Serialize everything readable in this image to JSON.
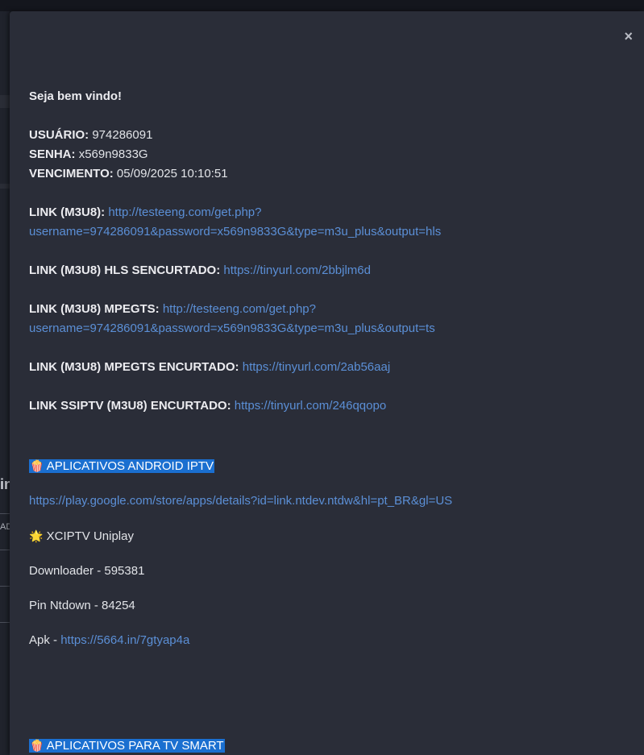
{
  "modal": {
    "close_label": "×",
    "greeting": "Seja bem vindo!",
    "user_label": "USUÁRIO:",
    "user_value": "974286091",
    "password_label": "SENHA:",
    "password_value": "x569n9833G",
    "expiry_label": "VENCIMENTO:",
    "expiry_value": "05/09/2025 10:10:51",
    "links": [
      {
        "label": "LINK (M3U8):",
        "url_line1": "http://testeeng.com/get.php?",
        "url_line2": "username=974286091&password=x569n9833G&type=m3u_plus&output=hls"
      },
      {
        "label": "LINK (M3U8) HLS SENCURTADO:",
        "url": "https://tinyurl.com/2bbjlm6d"
      },
      {
        "label": "LINK (M3U8) MPEGTS:",
        "url_line1": "http://testeeng.com/get.php?",
        "url_line2": "username=974286091&password=x569n9833G&type=m3u_plus&output=ts"
      },
      {
        "label": "LINK (M3U8) MPEGTS ENCURTADO:",
        "url": "https://tinyurl.com/2ab56aaj"
      },
      {
        "label": "LINK SSIPTV (M3U8) ENCURTADO:",
        "url": "https://tinyurl.com/246qqopo"
      }
    ],
    "android_section": {
      "icon": "🍿",
      "title": "APLICATIVOS ANDROID IPTV",
      "play_link": "https://play.google.com/store/apps/details?id=link.ntdev.ntdw&hl=pt_BR&gl=US",
      "xciptv_icon": "🌟",
      "xciptv": "XCIPTV Uniplay",
      "downloader": "Downloader - 595381",
      "pin": "Pin Ntdown - 84254",
      "apk_label": "Apk - ",
      "apk_link": "https://5664.in/7gtyap4a"
    },
    "smart_section": {
      "icon": "🍿",
      "title": "APLICATIVOS PARA TV SMART"
    }
  },
  "background": {
    "heading_fragment": "in",
    "column_fragment": "AD"
  }
}
